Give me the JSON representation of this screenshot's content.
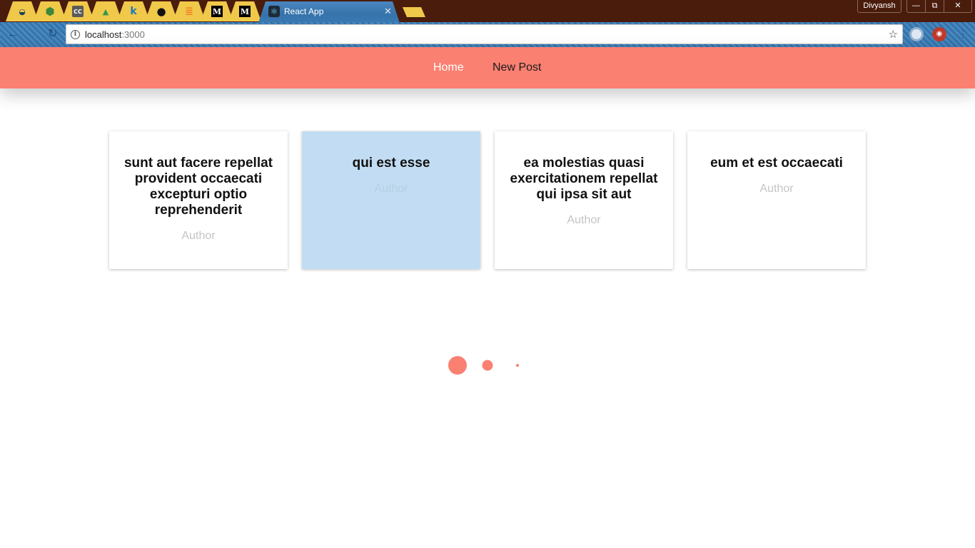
{
  "browser": {
    "tabs": [
      {
        "icon": "app-icon-1",
        "glyph": "◒",
        "color": "#1c3f63"
      },
      {
        "icon": "nodejs-icon",
        "glyph": "⬢",
        "color": "#3c873a"
      },
      {
        "icon": "cc-icon",
        "glyph": "CC",
        "color": "#ffffff",
        "bg": "#555555"
      },
      {
        "icon": "drive-icon",
        "glyph": "▲",
        "color": "#2b9a4a"
      },
      {
        "icon": "k-icon",
        "glyph": "k",
        "color": "#1a79c2"
      },
      {
        "icon": "github-icon",
        "glyph": "●",
        "color": "#111111"
      },
      {
        "icon": "stackoverflow-icon",
        "glyph": "≣",
        "color": "#f48024"
      },
      {
        "icon": "medium-icon",
        "glyph": "M",
        "color": "#ffffff",
        "bg": "#000000"
      },
      {
        "icon": "medium-icon",
        "glyph": "M",
        "color": "#ffffff",
        "bg": "#000000"
      }
    ],
    "active_tab": {
      "title": "React App",
      "close": "✕"
    },
    "profile": "Divyansh",
    "window_controls": {
      "minimize": "—",
      "maximize": "⧉",
      "close": "✕"
    },
    "url_host": "localhost",
    "url_port": ":3000"
  },
  "nav": {
    "home": "Home",
    "new_post": "New Post",
    "background": "#fa8072"
  },
  "posts": [
    {
      "title": "sunt aut facere repellat provident occaecati excepturi optio reprehenderit",
      "author": "Author"
    },
    {
      "title": "qui est esse",
      "author": "Author"
    },
    {
      "title": "ea molestias quasi exercitationem repellat qui ipsa sit aut",
      "author": "Author"
    },
    {
      "title": "eum et est occaecati",
      "author": "Author"
    }
  ],
  "highlight_color": "#c2ddf3"
}
